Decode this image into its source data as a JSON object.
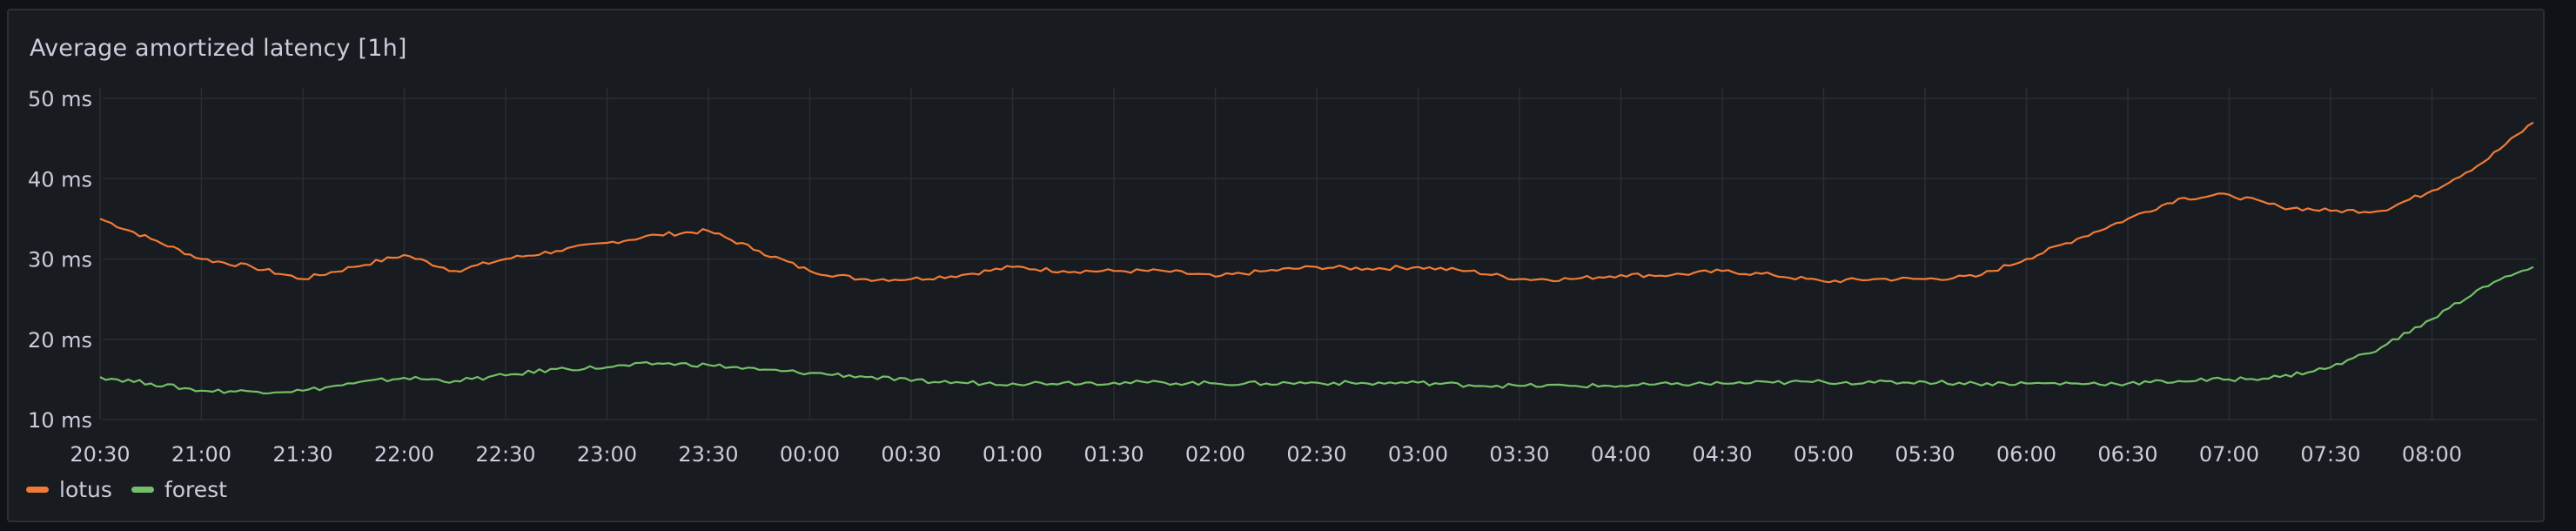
{
  "panel": {
    "title": "Average amortized latency [1h]"
  },
  "colors": {
    "background": "#111217",
    "panel": "#181b1f",
    "grid": "#2a2d33",
    "text": "#ccccdc",
    "lotus": "#f07b36",
    "forest": "#73bf69"
  },
  "legend": {
    "items": [
      {
        "label": "lotus",
        "color": "#f07b36"
      },
      {
        "label": "forest",
        "color": "#73bf69"
      }
    ],
    "placement": "bottom-left"
  },
  "chart_data": {
    "type": "line",
    "title": "Average amortized latency [1h]",
    "xlabel": "",
    "ylabel": "",
    "y_unit": "ms",
    "ylim": [
      10,
      50
    ],
    "y_ticks": [
      10,
      20,
      30,
      40,
      50
    ],
    "y_tick_labels": [
      "10 ms",
      "20 ms",
      "30 ms",
      "40 ms",
      "50 ms"
    ],
    "x_ticks": [
      "20:30",
      "21:00",
      "21:30",
      "22:00",
      "22:30",
      "23:00",
      "23:30",
      "00:00",
      "00:30",
      "01:00",
      "01:30",
      "02:00",
      "02:30",
      "03:00",
      "03:30",
      "04:00",
      "04:30",
      "05:00",
      "05:30",
      "06:00",
      "06:30",
      "07:00",
      "07:30",
      "08:00"
    ],
    "grid": true,
    "x": [
      "20:30",
      "20:45",
      "21:00",
      "21:15",
      "21:30",
      "21:45",
      "22:00",
      "22:15",
      "22:30",
      "22:45",
      "23:00",
      "23:15",
      "23:30",
      "23:45",
      "00:00",
      "00:15",
      "00:30",
      "00:45",
      "01:00",
      "01:15",
      "01:30",
      "01:45",
      "02:00",
      "02:15",
      "02:30",
      "02:45",
      "03:00",
      "03:15",
      "03:30",
      "03:45",
      "04:00",
      "04:15",
      "04:30",
      "04:45",
      "05:00",
      "05:15",
      "05:30",
      "05:45",
      "06:00",
      "06:15",
      "06:30",
      "06:45",
      "07:00",
      "07:15",
      "07:30",
      "07:45",
      "08:00",
      "08:15",
      "08:30"
    ],
    "series": [
      {
        "name": "lotus",
        "color": "#f07b36",
        "values": [
          35,
          32.5,
          30,
          29,
          27.5,
          29,
          30.5,
          28.5,
          30,
          31,
          32,
          33,
          33.5,
          31,
          28.5,
          27.5,
          27.5,
          28,
          29,
          28.5,
          28.5,
          28.5,
          27.8,
          28.5,
          29,
          28.8,
          29,
          28.5,
          27.5,
          27.5,
          28,
          28,
          28.5,
          28,
          27.2,
          27.5,
          27.5,
          27.8,
          30,
          32.5,
          35,
          37.5,
          38,
          36.5,
          36,
          36,
          38.5,
          42,
          47
        ]
      },
      {
        "name": "forest",
        "color": "#73bf69",
        "values": [
          15.3,
          14.5,
          13.6,
          13.5,
          13.6,
          14.5,
          15.2,
          14.8,
          15.5,
          16.3,
          16.5,
          17,
          16.8,
          16.2,
          15.8,
          15.4,
          14.8,
          14.6,
          14.5,
          14.6,
          14.6,
          14.6,
          14.5,
          14.5,
          14.6,
          14.5,
          14.6,
          14.3,
          14.2,
          14.2,
          14.2,
          14.4,
          14.5,
          14.6,
          14.7,
          14.6,
          14.7,
          14.5,
          14.5,
          14.5,
          14.5,
          14.8,
          15,
          15.3,
          16.5,
          19,
          22.5,
          26.5,
          29
        ]
      }
    ]
  }
}
